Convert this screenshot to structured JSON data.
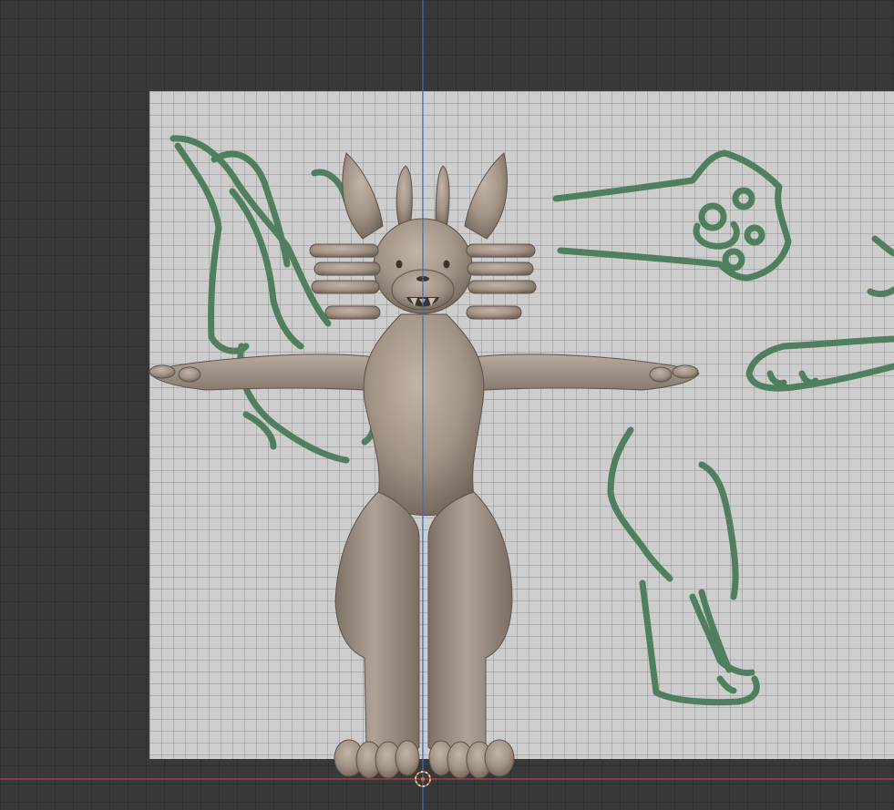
{
  "app": "3D viewport",
  "viewport": {
    "background_color": "#393939",
    "grid_color": "#303030",
    "x_axis_color": "#b0404a",
    "z_axis_color": "#3c6dbf"
  },
  "reference_image": {
    "background_color": "#cdcdcd",
    "sketch_color": "#4f7f5e"
  },
  "model": {
    "type": "character sculpt, T-pose",
    "color": "#a39486"
  },
  "world_origin": {
    "icon": "origin-crosshair-icon",
    "color": "#e0723a"
  }
}
